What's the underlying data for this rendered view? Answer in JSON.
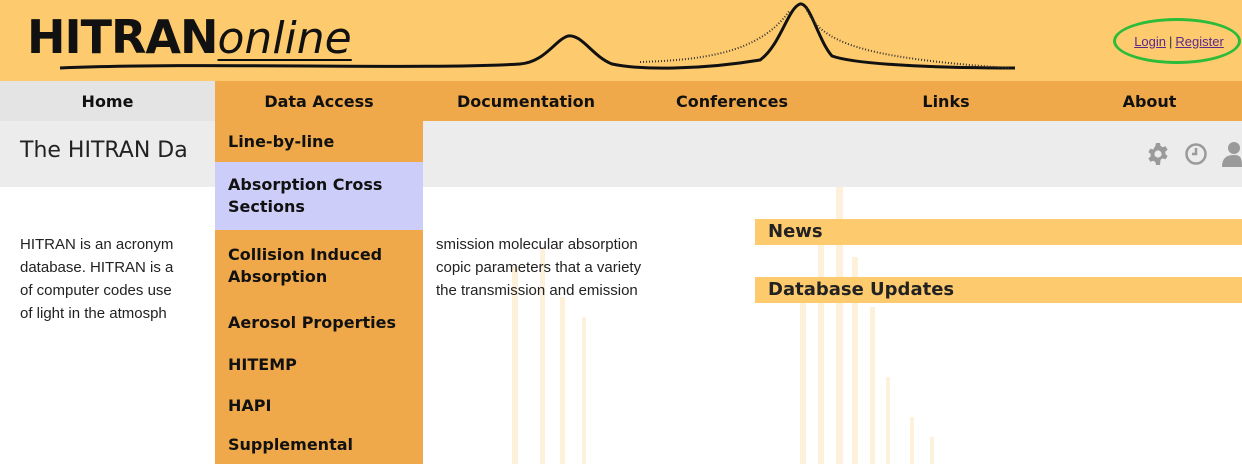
{
  "header": {
    "logo_bold": "HITRAN",
    "logo_italic": "online",
    "login_label": "Login",
    "separator": "|",
    "register_label": "Register",
    "accent_color": "#fdcb6e",
    "highlight_ring_color": "#2dbb3a"
  },
  "nav": {
    "items": [
      {
        "label": "Home"
      },
      {
        "label": "Data Access",
        "active": true
      },
      {
        "label": "Documentation"
      },
      {
        "label": "Conferences"
      },
      {
        "label": "Links"
      },
      {
        "label": "About"
      }
    ],
    "bar_color": "#f0a94a"
  },
  "dropdown": {
    "items": [
      {
        "line1": "Line-by-line",
        "line2": ""
      },
      {
        "line1": "Absorption Cross",
        "line2": "Sections",
        "hovered": true
      },
      {
        "line1": "Collision Induced",
        "line2": "Absorption"
      },
      {
        "line1": "Aerosol Properties",
        "line2": ""
      },
      {
        "line1": "HITEMP",
        "line2": ""
      },
      {
        "line1": "HAPI",
        "line2": ""
      },
      {
        "line1": "Supplemental",
        "line2": ""
      }
    ],
    "hover_color": "#cdcdfa"
  },
  "page": {
    "title_visible": "The HITRAN Da",
    "tool_icons": [
      "gear-icon",
      "clock-icon",
      "user-icon"
    ]
  },
  "intro": {
    "lines": [
      "HITRAN is an acronym",
      "database. HITRAN is a",
      "of computer codes use",
      "of light in the atmosph"
    ],
    "lines_right": [
      "smission molecular absorption",
      "copic parameters that a variety",
      "the transmission and emission",
      ""
    ]
  },
  "sidebar": {
    "news_label": "News",
    "updates_label": "Database Updates"
  }
}
